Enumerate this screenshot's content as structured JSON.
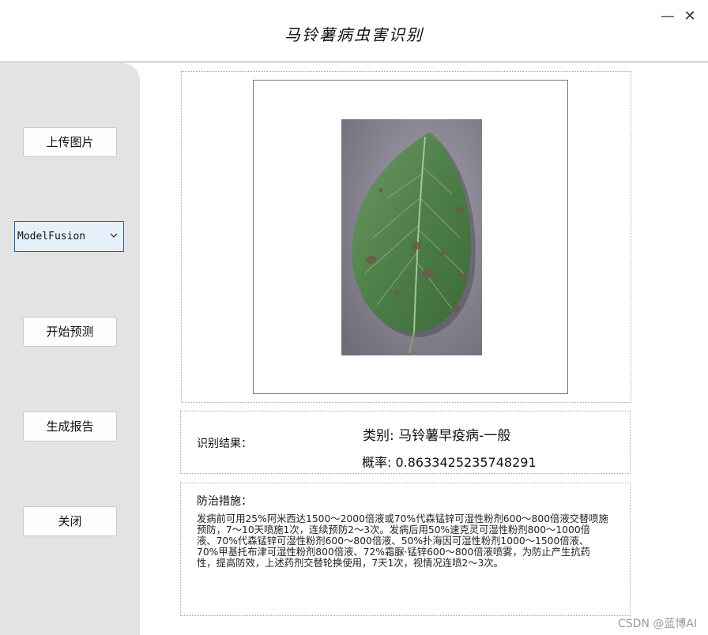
{
  "window": {
    "title": "马铃薯病虫害识别",
    "minimize_glyph": "—",
    "close_glyph": "✕"
  },
  "sidebar": {
    "upload_label": "上传图片",
    "model_select": {
      "value": "ModelFusion"
    },
    "predict_label": "开始预测",
    "report_label": "生成报告",
    "close_label": "关闭"
  },
  "result": {
    "label": "识别结果：",
    "class_text": "类别: 马铃薯早疫病-一般",
    "prob_text": "概率: 0.8633425235748291"
  },
  "treatment": {
    "label": "防治措施：",
    "text": "发病前可用25%阿米西达1500～2000倍液或70%代森锰锌可湿性粉剂600～800倍液交替喷施预防，7～10天喷施1次，连续预防2～3次。发病后用50%速克灵可湿性粉剂800～1000倍液、70%代森锰锌可湿性粉剂600～800倍液、50%扑海因可湿性粉剂1000～1500倍液、70%甲基托布津可湿性粉剂800倍液、72%霜脲·锰锌600～800倍液喷雾，为防止产生抗药性，提高防效，上述药剂交替轮换使用，7天1次，视情况连喷2～3次。"
  },
  "watermark": "CSDN @蓝博AI",
  "icons": {
    "minimize": "minimize-icon",
    "close": "close-icon",
    "dropdown": "chevron-down-icon"
  },
  "colors": {
    "sidebar_bg": "#e3e3e3",
    "select_border": "#0a66c2",
    "select_bg": "#e6f1fb"
  }
}
